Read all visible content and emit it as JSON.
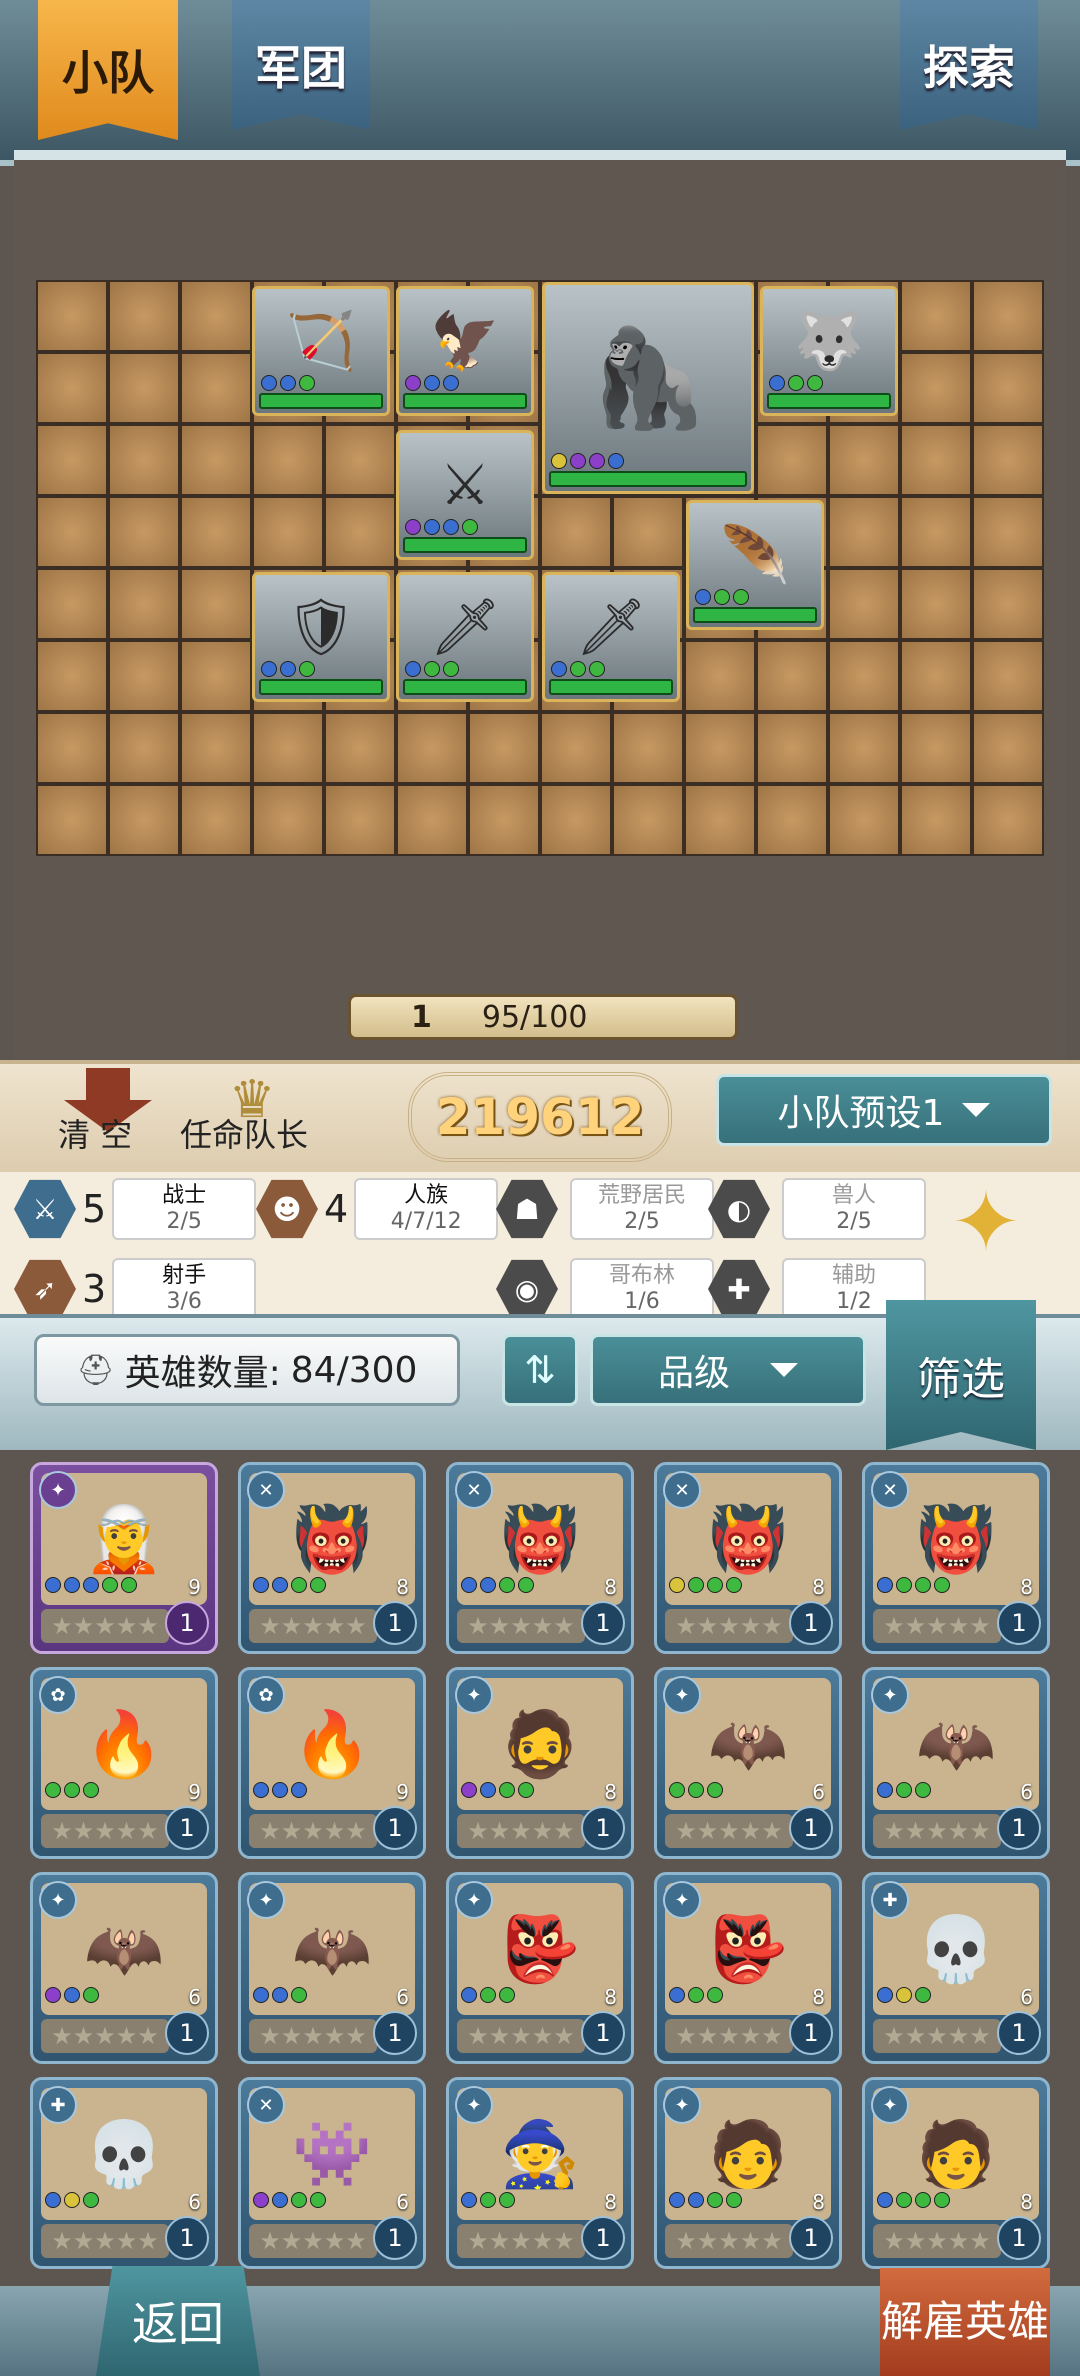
{
  "tabs": {
    "squad": "小队",
    "legion": "军团",
    "explore": "探索"
  },
  "progress": {
    "level": "1",
    "capacity": "95/100"
  },
  "actions": {
    "clear": "清 空",
    "appoint_captain": "任命队长"
  },
  "team_power": "219612",
  "preset": {
    "label": "小队预设1"
  },
  "synergies": [
    {
      "count": "5",
      "name": "战士",
      "progress": "2/5",
      "icon": "sword-icon",
      "active": true
    },
    {
      "count": "4",
      "name": "人族",
      "progress": "4/7/12",
      "icon": "human-face-icon",
      "active": true
    },
    {
      "count": "",
      "name": "荒野居民",
      "progress": "2/5",
      "icon": "wild-icon",
      "active": false
    },
    {
      "count": "",
      "name": "兽人",
      "progress": "2/5",
      "icon": "orc-icon",
      "active": false
    },
    {
      "count": "3",
      "name": "射手",
      "progress": "3/6",
      "icon": "bow-icon",
      "active": true
    },
    {
      "count": "",
      "name": "哥布林",
      "progress": "1/6",
      "icon": "goblin-icon",
      "active": false
    },
    {
      "count": "",
      "name": "辅助",
      "progress": "1/2",
      "icon": "support-icon",
      "active": false
    }
  ],
  "hero_list": {
    "count_label": "英雄数量:",
    "count_value": "84/300",
    "sort_label": "品级",
    "filter_label": "筛选"
  },
  "heroes": [
    {
      "cost": "9",
      "level": "1",
      "dots": [
        "#3a6fd1",
        "#3a6fd1",
        "#3a6fd1",
        "#3fb83f",
        "#3fb83f"
      ],
      "rarity": "purple"
    },
    {
      "cost": "8",
      "level": "1",
      "dots": [
        "#3a6fd1",
        "#3a6fd1",
        "#3fb83f",
        "#3fb83f"
      ],
      "rarity": "blue"
    },
    {
      "cost": "8",
      "level": "1",
      "dots": [
        "#3a6fd1",
        "#3a6fd1",
        "#3fb83f",
        "#3fb83f"
      ],
      "rarity": "blue"
    },
    {
      "cost": "8",
      "level": "1",
      "dots": [
        "#d9c33a",
        "#3fb83f",
        "#3fb83f",
        "#3fb83f"
      ],
      "rarity": "blue"
    },
    {
      "cost": "8",
      "level": "1",
      "dots": [
        "#3a6fd1",
        "#3fb83f",
        "#3fb83f",
        "#3fb83f"
      ],
      "rarity": "blue"
    },
    {
      "cost": "9",
      "level": "1",
      "dots": [
        "#3fb83f",
        "#3fb83f",
        "#3fb83f"
      ],
      "rarity": "blue"
    },
    {
      "cost": "9",
      "level": "1",
      "dots": [
        "#3a6fd1",
        "#3a6fd1",
        "#3a6fd1"
      ],
      "rarity": "blue"
    },
    {
      "cost": "8",
      "level": "1",
      "dots": [
        "#8c3fc8",
        "#3a6fd1",
        "#3fb83f",
        "#3fb83f"
      ],
      "rarity": "blue"
    },
    {
      "cost": "6",
      "level": "1",
      "dots": [
        "#3fb83f",
        "#3fb83f",
        "#3fb83f"
      ],
      "rarity": "blue"
    },
    {
      "cost": "6",
      "level": "1",
      "dots": [
        "#3a6fd1",
        "#3fb83f",
        "#3fb83f"
      ],
      "rarity": "blue"
    },
    {
      "cost": "6",
      "level": "1",
      "dots": [
        "#8c3fc8",
        "#3a6fd1",
        "#3fb83f"
      ],
      "rarity": "blue"
    },
    {
      "cost": "6",
      "level": "1",
      "dots": [
        "#3a6fd1",
        "#3a6fd1",
        "#3fb83f"
      ],
      "rarity": "blue"
    },
    {
      "cost": "8",
      "level": "1",
      "dots": [
        "#3a6fd1",
        "#3fb83f",
        "#3fb83f"
      ],
      "rarity": "blue"
    },
    {
      "cost": "8",
      "level": "1",
      "dots": [
        "#3a6fd1",
        "#3fb83f",
        "#3fb83f"
      ],
      "rarity": "blue"
    },
    {
      "cost": "6",
      "level": "1",
      "dots": [
        "#3a6fd1",
        "#d9c33a",
        "#3fb83f"
      ],
      "rarity": "blue"
    },
    {
      "cost": "6",
      "level": "1",
      "dots": [
        "#3a6fd1",
        "#d9c33a",
        "#3fb83f"
      ],
      "rarity": "blue"
    },
    {
      "cost": "6",
      "level": "1",
      "dots": [
        "#8c3fc8",
        "#3a6fd1",
        "#3fb83f",
        "#3fb83f"
      ],
      "rarity": "blue"
    },
    {
      "cost": "8",
      "level": "1",
      "dots": [
        "#3a6fd1",
        "#3fb83f",
        "#3fb83f"
      ],
      "rarity": "blue"
    },
    {
      "cost": "8",
      "level": "1",
      "dots": [
        "#3a6fd1",
        "#3a6fd1",
        "#3fb83f",
        "#3fb83f"
      ],
      "rarity": "blue"
    },
    {
      "cost": "8",
      "level": "1",
      "dots": [
        "#3a6fd1",
        "#3fb83f",
        "#3fb83f",
        "#3fb83f"
      ],
      "rarity": "blue"
    }
  ],
  "bottom": {
    "back": "返回",
    "dismiss": "解雇英雄"
  }
}
